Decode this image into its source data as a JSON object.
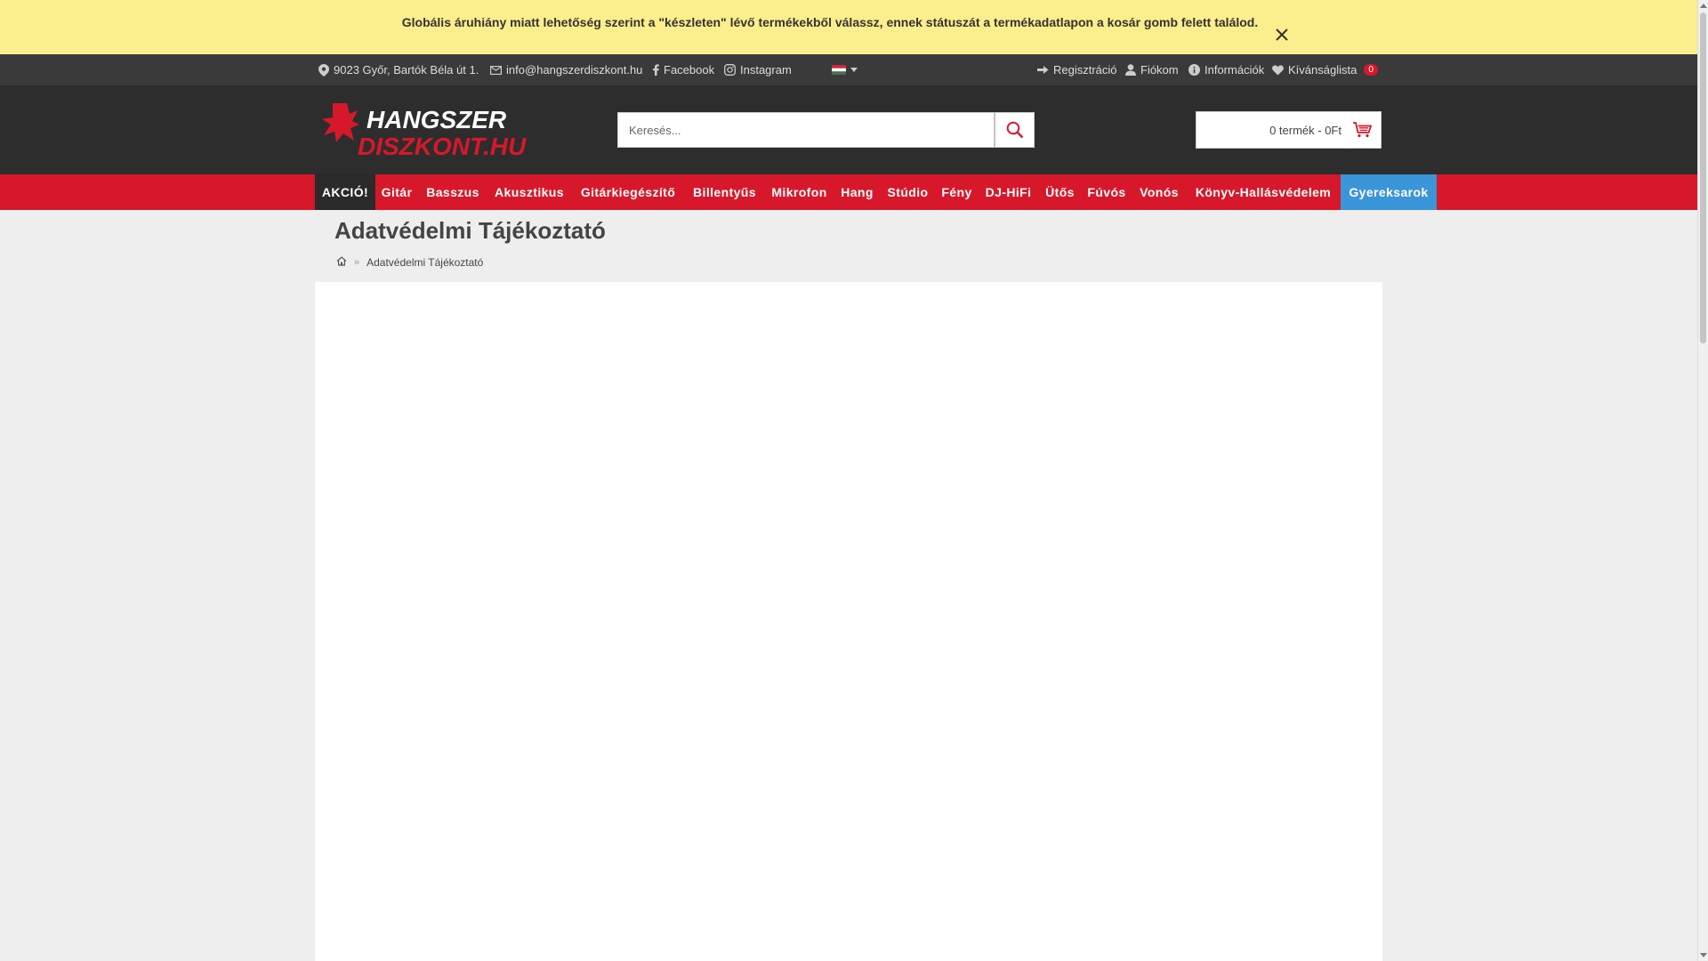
{
  "notice": {
    "text": "Globális áruhiány miatt lehetőség szerint a \"készleten\" lévő termékekből válassz, ennek státuszát a termékadatlapon a kosár gomb felett találod.",
    "close_icon": "close-icon"
  },
  "topbar": {
    "address": "9023 Győr, Bartók Béla út 1.",
    "email": "info@hangszerdiszkont.hu",
    "facebook": "Facebook",
    "instagram": "Instagram",
    "language_flag": "hungarian-flag-icon",
    "register": "Regisztráció",
    "account": "Fiókom",
    "info": "Információk",
    "wishlist": "Kívánságlista",
    "wishlist_count": "0"
  },
  "header": {
    "logo_line1": "HANGSZER",
    "logo_line2": "DISZKONT.HU",
    "search_placeholder": "Keresés...",
    "cart_label": "0 termék - 0Ft"
  },
  "nav": {
    "items": [
      {
        "label": "AKCIÓ!"
      },
      {
        "label": "Gitár"
      },
      {
        "label": "Basszus"
      },
      {
        "label": "Akusztikus"
      },
      {
        "label": "Gitárkiegészítő"
      },
      {
        "label": "Billentyűs"
      },
      {
        "label": "Mikrofon"
      },
      {
        "label": "Hang"
      },
      {
        "label": "Stúdio"
      },
      {
        "label": "Fény"
      },
      {
        "label": "DJ-HiFi"
      },
      {
        "label": "Ütős"
      },
      {
        "label": "Fúvós"
      },
      {
        "label": "Vonós"
      },
      {
        "label": "Könyv-Hallásvédelem"
      },
      {
        "label": "Gyereksarok"
      }
    ]
  },
  "page": {
    "title": "Adatvédelmi Tájékoztató",
    "breadcrumb_current": "Adatvédelmi Tájékoztató"
  },
  "colors": {
    "notice_bg": "#fbee8c",
    "topbar_bg": "#3a3a3a",
    "header_bg": "#2d2d2d",
    "nav_bg": "#d7182a",
    "nav_akcio_bg": "#2a2a2a",
    "nav_kids_bg": "#3b95d9",
    "page_bg": "#eeeeee"
  }
}
